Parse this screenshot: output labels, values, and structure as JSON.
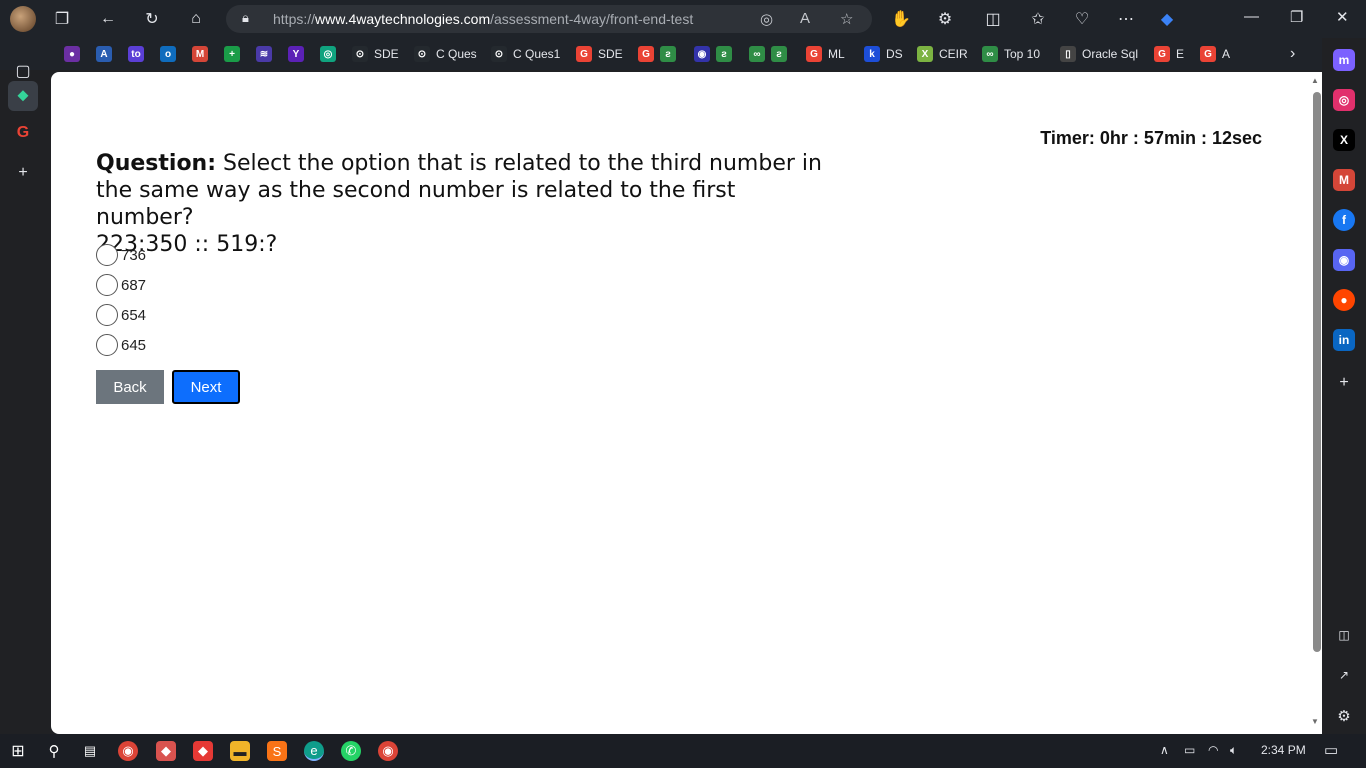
{
  "browser": {
    "url_prefix": "https://",
    "url_host": "www.4waytechnologies.com",
    "url_path": "/assessment-4way/front-end-test"
  },
  "favorites": [
    {
      "label": "",
      "color": "#6b2fa3",
      "glyph": "●"
    },
    {
      "label": "",
      "color": "#2a5db0",
      "glyph": "A"
    },
    {
      "label": "",
      "color": "#5b3fd6",
      "glyph": "to"
    },
    {
      "label": "",
      "color": "#0f6cbd",
      "glyph": "o"
    },
    {
      "label": "",
      "color": "#d44638",
      "glyph": "M"
    },
    {
      "label": "",
      "color": "#1a9c48",
      "glyph": "+"
    },
    {
      "label": "",
      "color": "#4a3aa8",
      "glyph": "≋"
    },
    {
      "label": "",
      "color": "#5b21b6",
      "glyph": "Y"
    },
    {
      "label": "",
      "color": "#10a37f",
      "glyph": "◎"
    },
    {
      "label": "SDE",
      "color": "#24292e",
      "glyph": "⊙"
    },
    {
      "label": "C Ques",
      "color": "#24292e",
      "glyph": "⊙"
    },
    {
      "label": "C Ques1",
      "color": "#24292e",
      "glyph": "⊙"
    },
    {
      "label": "SDE",
      "color": "#ea4335",
      "glyph": "G"
    },
    {
      "label": "",
      "color": "#ea4335",
      "glyph": "G"
    },
    {
      "label": "",
      "color": "#2f8d46",
      "glyph": "ƨ"
    },
    {
      "label": "",
      "color": "#3333aa",
      "glyph": "◉"
    },
    {
      "label": "",
      "color": "#2f8d46",
      "glyph": "ƨ"
    },
    {
      "label": "",
      "color": "#2f8d46",
      "glyph": "∞"
    },
    {
      "label": "",
      "color": "#2f8d46",
      "glyph": "ƨ"
    },
    {
      "label": "ML",
      "color": "#ea4335",
      "glyph": "G"
    },
    {
      "label": "DS",
      "color": "#1d4ed8",
      "glyph": "k"
    },
    {
      "label": "CEIR",
      "color": "#7cb342",
      "glyph": "X"
    },
    {
      "label": "Top 10",
      "color": "#2f8d46",
      "glyph": "∞"
    },
    {
      "label": "Oracle Sql",
      "color": "#444",
      "glyph": "▯"
    },
    {
      "label": "E",
      "color": "#ea4335",
      "glyph": "G"
    },
    {
      "label": "A",
      "color": "#ea4335",
      "glyph": "G"
    }
  ],
  "page": {
    "timer": "Timer: 0hr : 57min : 12sec",
    "question_label": "Question:",
    "question_text": " Select the option that is related to the third number in the same way as the second number is related to the first number?",
    "question_pair": "223:350 :: 519:?",
    "options": [
      "736",
      "687",
      "654",
      "645"
    ],
    "back_label": "Back",
    "next_label": "Next"
  },
  "taskbar": {
    "time": "2:34 PM"
  }
}
